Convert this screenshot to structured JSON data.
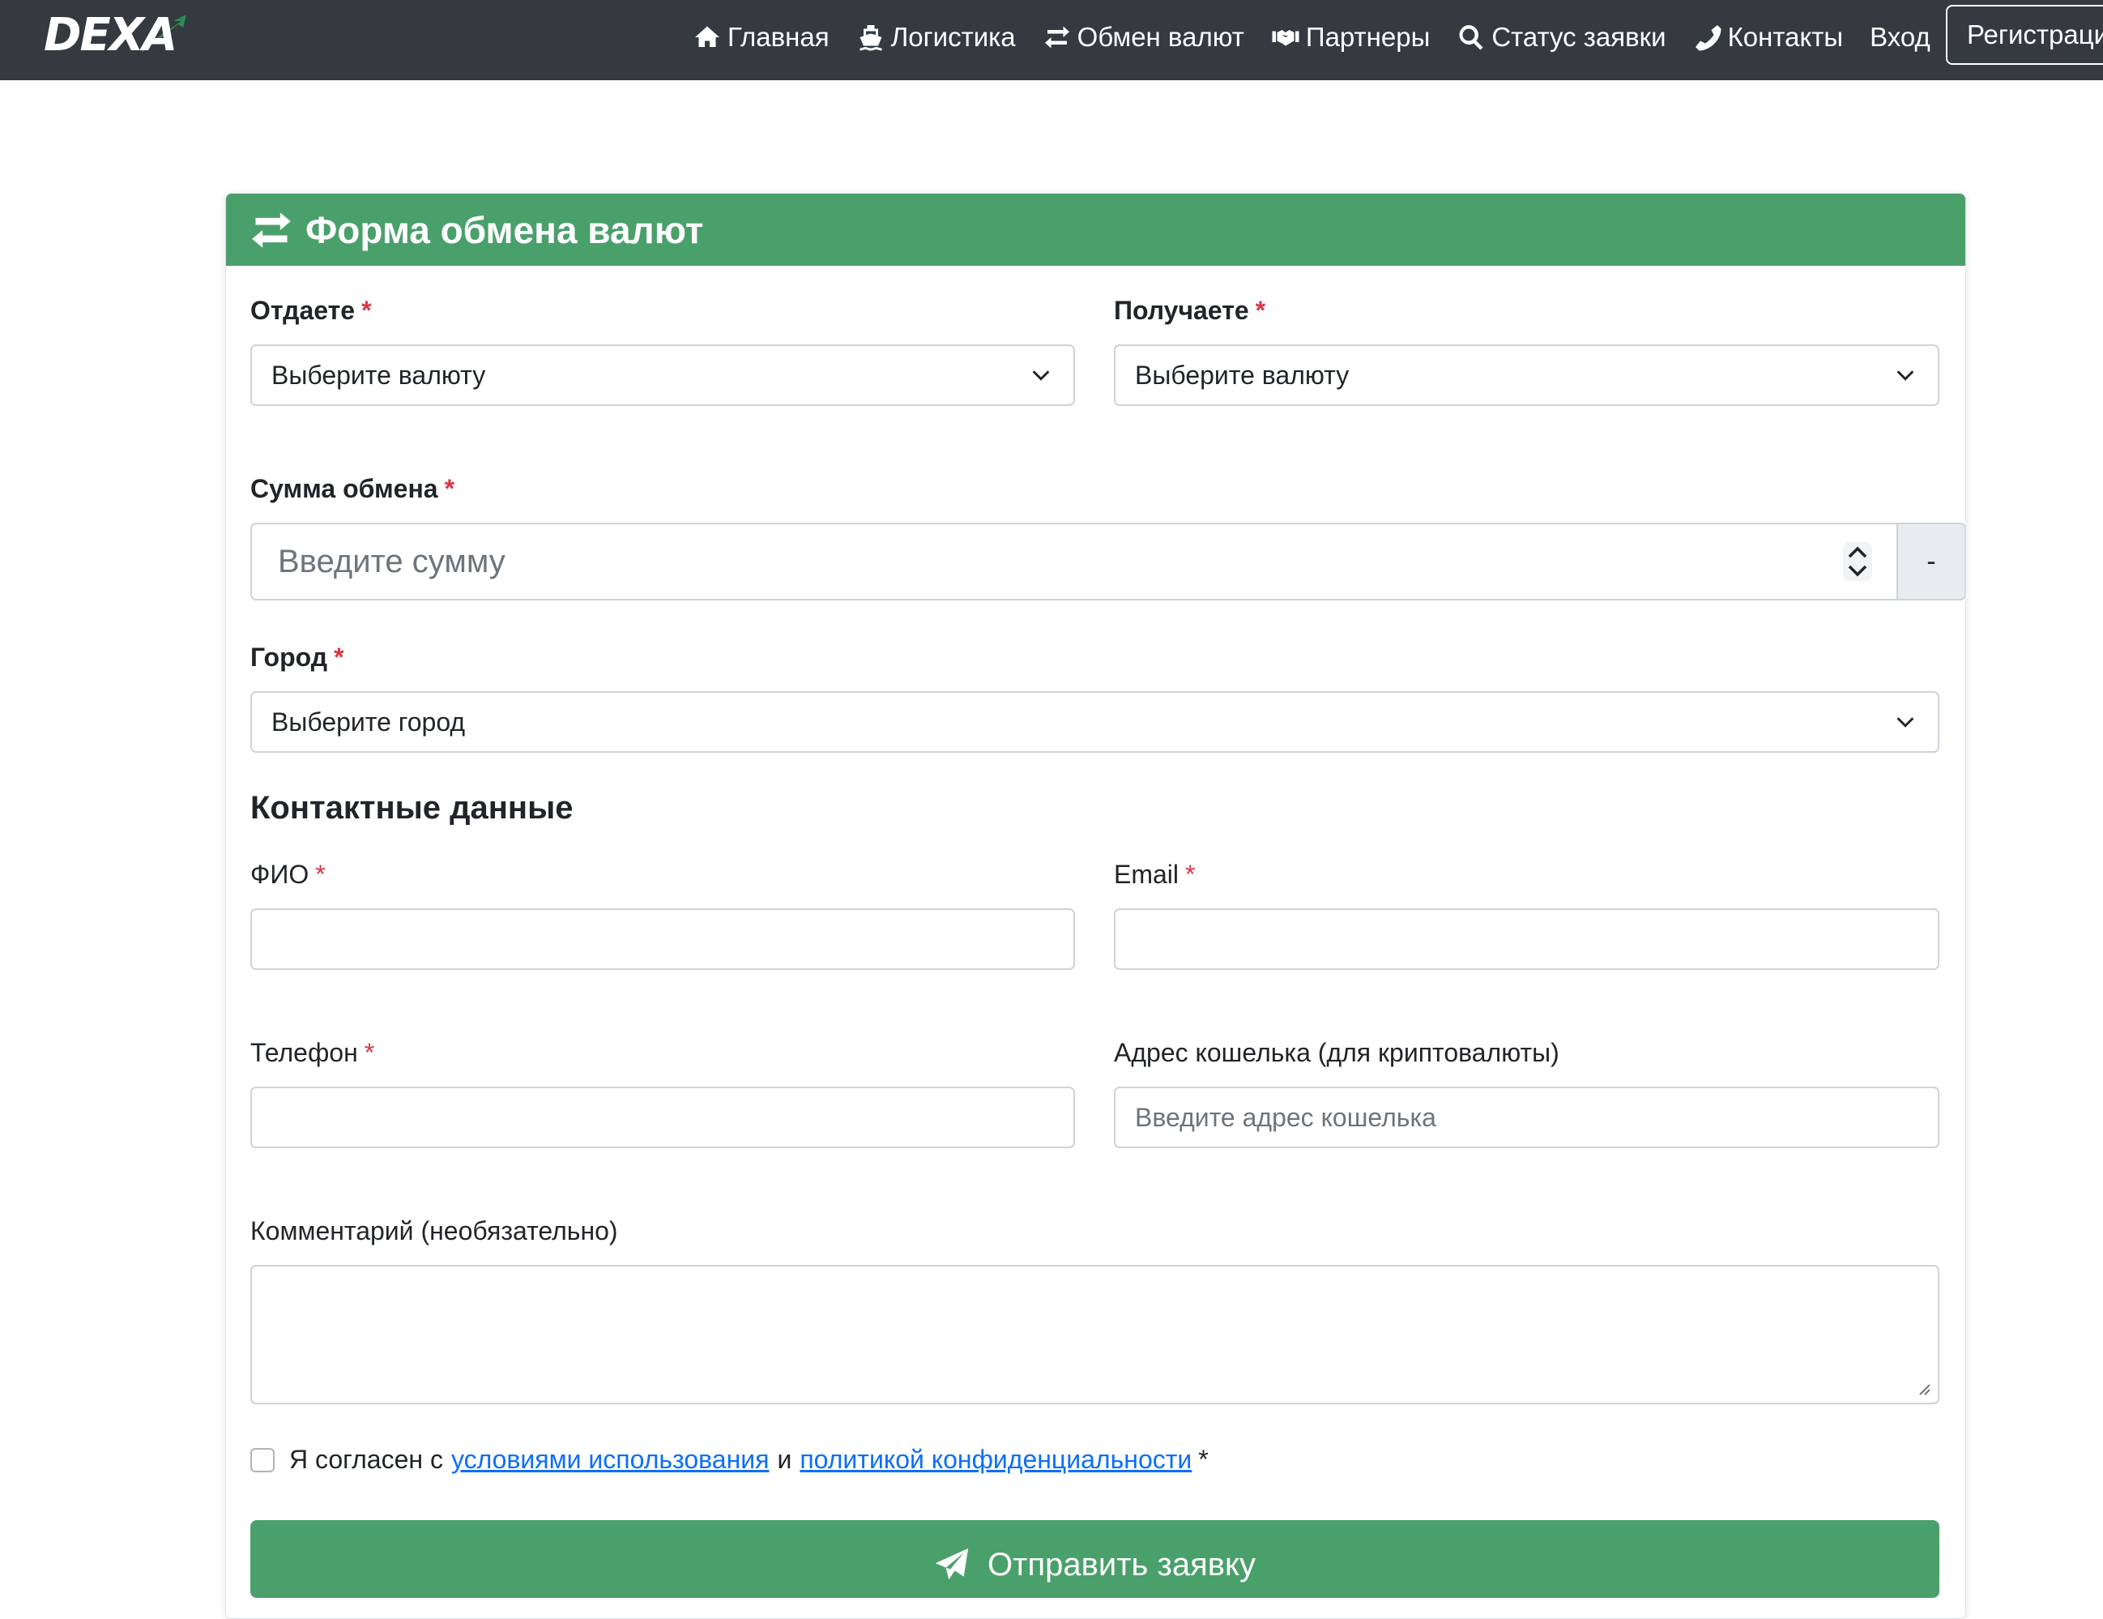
{
  "brand": {
    "logo_text": "DEXA",
    "accent_color": "#2e8b57"
  },
  "nav": {
    "items": [
      {
        "label": "Главная",
        "icon": "home-icon"
      },
      {
        "label": "Логистика",
        "icon": "ship-icon"
      },
      {
        "label": "Обмен валют",
        "icon": "exchange-icon"
      },
      {
        "label": "Партнеры",
        "icon": "handshake-icon"
      },
      {
        "label": "Статус заявки",
        "icon": "search-icon"
      },
      {
        "label": "Контакты",
        "icon": "phone-icon"
      },
      {
        "label": "Вход",
        "icon": ""
      }
    ],
    "register_label": "Регистрация"
  },
  "form": {
    "title": "Форма обмена валют",
    "header_color": "#4aa06b",
    "give": {
      "label": "Отдаете",
      "required_mark": "*",
      "value": "Выберите валюту"
    },
    "receive": {
      "label": "Получаете",
      "required_mark": "*",
      "value": "Выберите валюту"
    },
    "amount": {
      "label": "Сумма обмена",
      "required_mark": "*",
      "placeholder": "Введите сумму",
      "addon": "-"
    },
    "city": {
      "label": "Город",
      "required_mark": "*",
      "value": "Выберите город"
    },
    "contacts_title": "Контактные данные",
    "fio": {
      "label": "ФИО",
      "required_mark": "*",
      "value": ""
    },
    "email": {
      "label": "Email",
      "required_mark": "*",
      "value": ""
    },
    "phone": {
      "label": "Телефон",
      "required_mark": "*",
      "value": ""
    },
    "wallet": {
      "label": "Адрес кошелька (для криптовалюты)",
      "placeholder": "Введите адрес кошелька"
    },
    "comment": {
      "label": "Комментарий (необязательно)",
      "value": ""
    },
    "agree": {
      "prefix": "Я согласен с",
      "terms_link": "условиями использования",
      "conjunction": "и",
      "privacy_link": "политикой конфиденциальности",
      "required_mark": "*",
      "checked": false
    },
    "submit_label": "Отправить заявку"
  }
}
